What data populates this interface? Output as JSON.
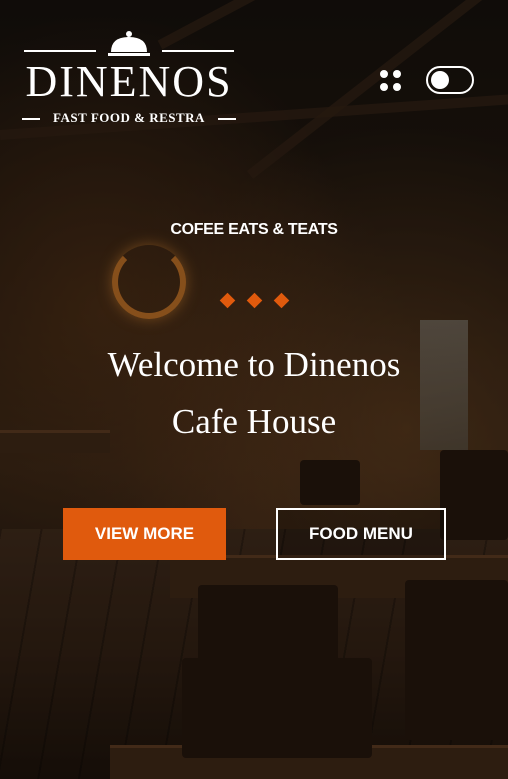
{
  "brand": {
    "name": "DINENOS",
    "tagline": "FAST FOOD & RESTRA"
  },
  "header": {
    "menu_icon": "grid-dots-icon",
    "theme_toggle": "theme-toggle-switch"
  },
  "hero": {
    "subtitle": "COFEE EATS & TEATS",
    "headline_line1": "Welcome to Dinenos",
    "headline_line2": "Cafe House",
    "primary_button": "VIEW MORE",
    "secondary_button": "FOOD MENU"
  },
  "colors": {
    "accent": "#e05a0d",
    "text": "#ffffff"
  }
}
